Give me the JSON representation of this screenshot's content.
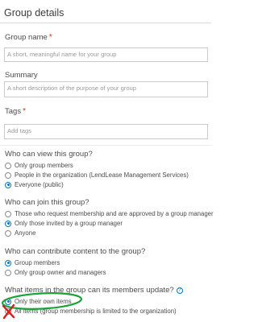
{
  "header": {
    "title": "Group details"
  },
  "form": {
    "group_name": {
      "label": "Group name",
      "required": "*",
      "placeholder": "A short, meaningful name for your group"
    },
    "summary": {
      "label": "Summary",
      "placeholder": "A short description of the purpose of your group"
    },
    "tags": {
      "label": "Tags",
      "required": "*",
      "placeholder": "Add tags"
    }
  },
  "view_section": {
    "question": "Who can view this group?",
    "options": [
      {
        "label": "Only group members",
        "selected": false
      },
      {
        "label": "People in the organization (LendLease Management Services)",
        "selected": false
      },
      {
        "label": "Everyone (public)",
        "selected": true
      }
    ]
  },
  "join_section": {
    "question": "Who can join this group?",
    "options": [
      {
        "label": "Those who request membership and are approved by a group manager",
        "selected": false
      },
      {
        "label": "Only those invited by a group manager",
        "selected": true
      },
      {
        "label": "Anyone",
        "selected": false
      }
    ]
  },
  "contribute_section": {
    "question": "Who can contribute content to the group?",
    "options": [
      {
        "label": "Group members",
        "selected": true
      },
      {
        "label": "Only group owner and managers",
        "selected": false
      }
    ]
  },
  "update_section": {
    "question": "What items in the group can its members update?",
    "help_glyph": "?",
    "options": [
      {
        "label": "Only their own items",
        "selected": true
      },
      {
        "label": "All items (group membership is limited to the organization)",
        "selected": false
      }
    ]
  },
  "annotations": {
    "highlight_color": "#1aa33a",
    "cross_color": "#d92020"
  }
}
